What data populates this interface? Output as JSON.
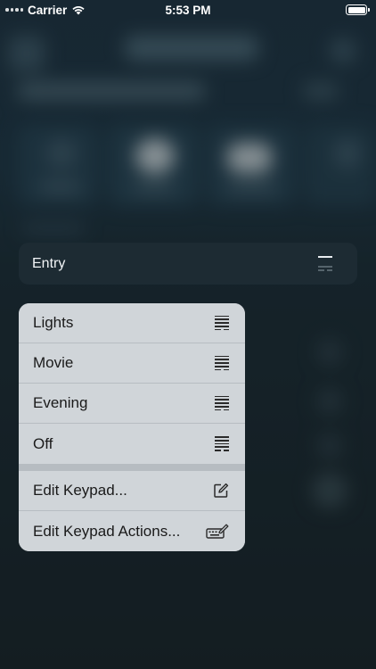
{
  "status_bar": {
    "carrier": "Carrier",
    "time": "5:53 PM"
  },
  "entry": {
    "label": "Entry",
    "icon": "keypad-icon"
  },
  "menu": {
    "scene_items": [
      {
        "label": "Lights",
        "icon": "keypad-icon"
      },
      {
        "label": "Movie",
        "icon": "keypad-icon"
      },
      {
        "label": "Evening",
        "icon": "keypad-icon"
      },
      {
        "label": "Off",
        "icon": "keypad-icon"
      }
    ],
    "action_items": [
      {
        "label": "Edit Keypad...",
        "icon": "edit-icon"
      },
      {
        "label": "Edit Keypad Actions...",
        "icon": "keyboard-edit-icon"
      }
    ]
  },
  "colors": {
    "background": "#1a252b",
    "menu_background": "#d0d5d9",
    "entry_row": "#1d2b33"
  }
}
